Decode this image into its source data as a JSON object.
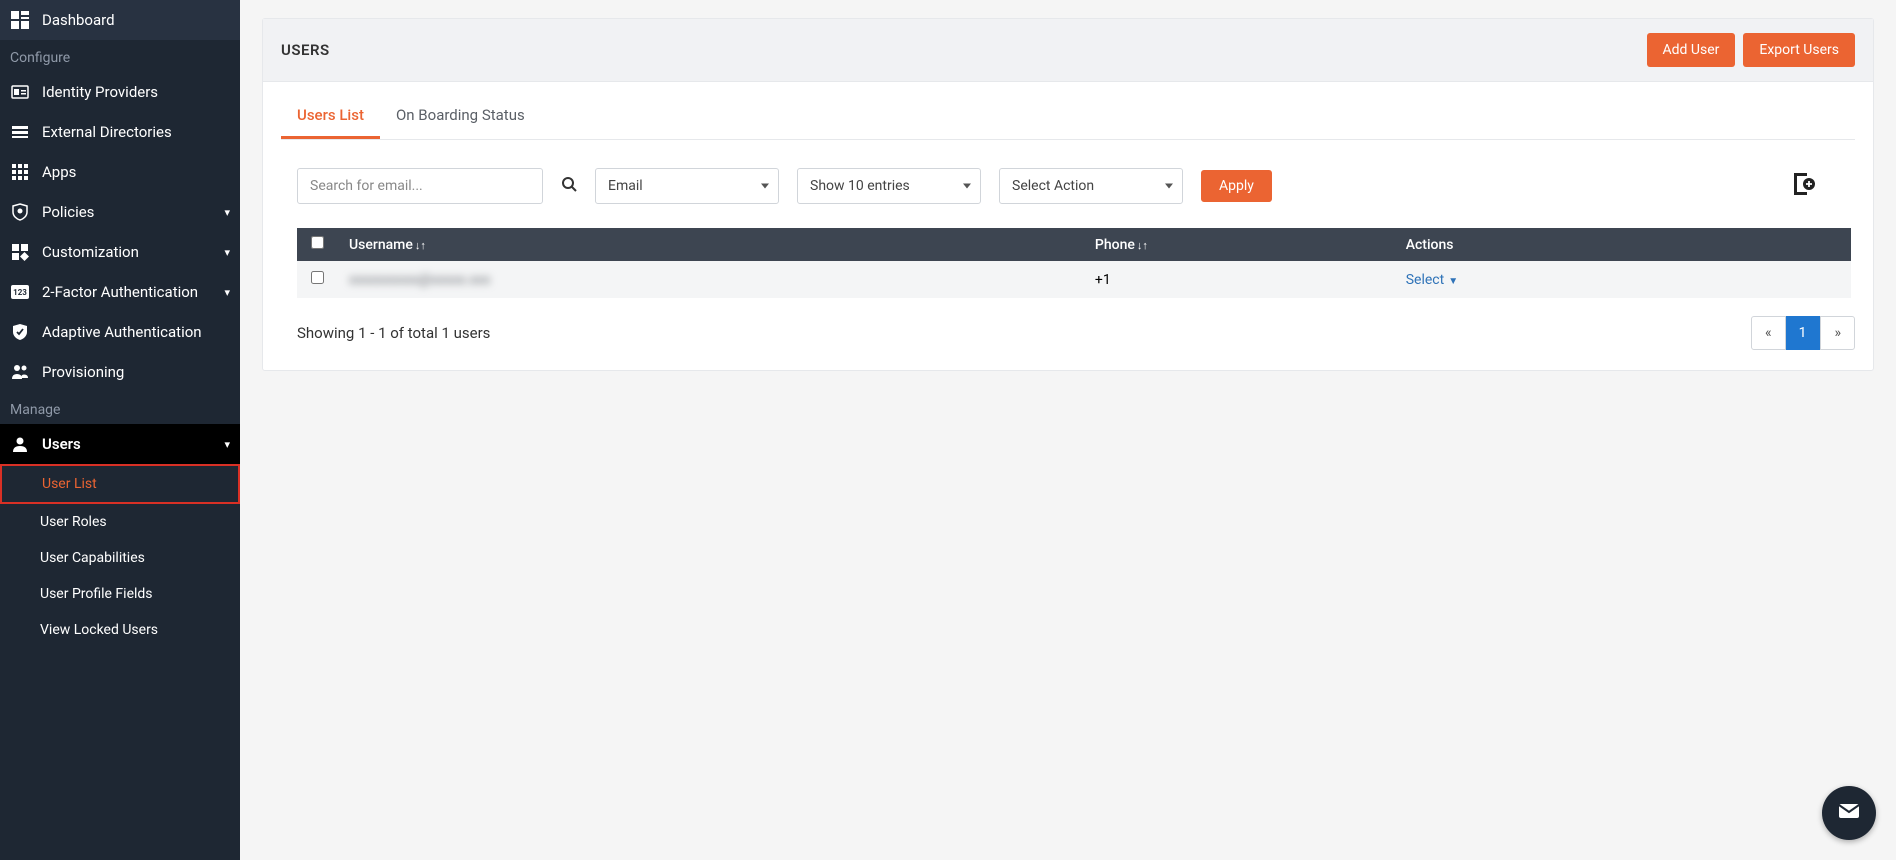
{
  "sidebar": {
    "items": [
      {
        "label": "Dashboard",
        "icon": "dashboard"
      },
      {
        "section": "Configure"
      },
      {
        "label": "Identity Providers",
        "icon": "idp"
      },
      {
        "label": "External Directories",
        "icon": "directories"
      },
      {
        "label": "Apps",
        "icon": "apps"
      },
      {
        "label": "Policies",
        "icon": "policies",
        "chevron": true
      },
      {
        "label": "Customization",
        "icon": "customization",
        "chevron": true
      },
      {
        "label": "2-Factor Authentication",
        "icon": "2fa",
        "chevron": true
      },
      {
        "label": "Adaptive Authentication",
        "icon": "adaptive"
      },
      {
        "label": "Provisioning",
        "icon": "provisioning"
      },
      {
        "section": "Manage"
      },
      {
        "label": "Users",
        "icon": "users",
        "chevron": true,
        "active": true
      }
    ],
    "submenu": [
      {
        "label": "User List",
        "highlighted": true
      },
      {
        "label": "User Roles"
      },
      {
        "label": "User Capabilities"
      },
      {
        "label": "User Profile Fields"
      },
      {
        "label": "View Locked Users"
      }
    ]
  },
  "header": {
    "title": "USERS",
    "add_user": "Add User",
    "export_users": "Export Users"
  },
  "tabs": {
    "users_list": "Users List",
    "onboarding": "On Boarding Status"
  },
  "filters": {
    "search_placeholder": "Search for email...",
    "select1": "Email",
    "select2": "Show 10 entries",
    "select3": "Select Action",
    "apply": "Apply"
  },
  "table": {
    "columns": {
      "username": "Username",
      "phone": "Phone",
      "actions": "Actions"
    },
    "rows": [
      {
        "username": "xxxxxxxxxx@xxxxx.xxx",
        "phone": "+1",
        "action": "Select"
      }
    ],
    "footer": "Showing 1 - 1 of total 1 users",
    "pager": {
      "prev": "«",
      "page": "1",
      "next": "»"
    }
  }
}
